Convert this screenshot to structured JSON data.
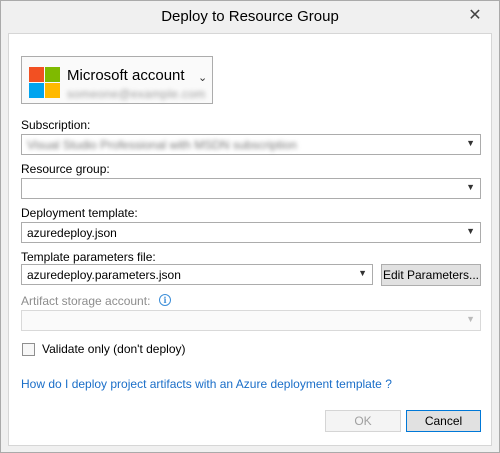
{
  "window": {
    "title": "Deploy to Resource Group",
    "close_glyph": "✕"
  },
  "account": {
    "provider": "Microsoft account",
    "email": "someone@example.com",
    "dropdown_glyph": "⌄"
  },
  "fields": {
    "subscription": {
      "label": "Subscription:",
      "value": "Visual Studio Professional with MSDN subscription"
    },
    "resource_group": {
      "label": "Resource group:",
      "value": ""
    },
    "deployment_template": {
      "label": "Deployment template:",
      "value": "azuredeploy.json"
    },
    "template_parameters": {
      "label": "Template parameters file:",
      "value": "azuredeploy.parameters.json"
    },
    "artifact_storage": {
      "label": "Artifact storage account:",
      "value": ""
    }
  },
  "icons": {
    "combo_arrow": "▼",
    "info": "i"
  },
  "buttons": {
    "edit_parameters": "Edit Parameters...",
    "ok": "OK",
    "cancel": "Cancel"
  },
  "validate_only": {
    "label": "Validate only (don't deploy)",
    "checked": false
  },
  "help_link": "How do I deploy project artifacts with an Azure deployment template ?",
  "colors": {
    "link": "#1a6ec8",
    "info": "#3c8ed8",
    "focus": "#0078d7"
  }
}
